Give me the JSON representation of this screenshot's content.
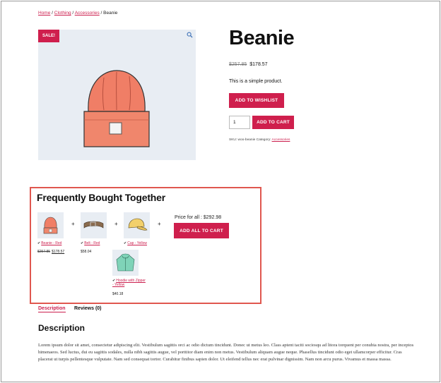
{
  "breadcrumb": {
    "links": [
      "Home",
      "Clothing",
      "Accessories"
    ],
    "separator": " / ",
    "current": "Beanie"
  },
  "gallery": {
    "badge": "SALE!",
    "zoom_icon": "magnifier-icon",
    "image": "beanie-illustration"
  },
  "product": {
    "title": "Beanie",
    "price_old": "$257.85",
    "price_new": "$178.57",
    "short_description": "This is a simple product.",
    "wishlist_label": "ADD TO WISHLIST",
    "quantity": "1",
    "add_to_cart_label": "ADD TO CART",
    "meta_prefix": "SKU: woo-beanie Category: ",
    "category": "Accessories"
  },
  "fbt": {
    "title": "Frequently Bought Together",
    "plus": "+",
    "check": "✔",
    "total_label": "Price for all : $292.98",
    "add_all_label": "ADD ALL TO CART",
    "items": [
      {
        "name": "Beanie - Red",
        "price_old": "$257.85",
        "price_new": "$178.57",
        "icon": "beanie-icon"
      },
      {
        "name": "Belt - Red",
        "price": "$58.04",
        "icon": "belt-icon"
      },
      {
        "name": "Cap - Yellow",
        "icon": "cap-icon"
      },
      {
        "name": "Hoodie with Zipper - Yellow",
        "price": "$40.18",
        "icon": "hoodie-icon"
      }
    ]
  },
  "tabs": {
    "description": "Description",
    "reviews": "Reviews (0)"
  },
  "description": {
    "heading": "Description",
    "body": "Lorem ipsum dolor sit amet, consectetur adipiscing elit. Vestibulum sagittis orci ac odio dictum tincidunt. Donec ut metus leo. Class aptent taciti sociosqu ad litora torquent per conubia nostra, per inceptos himenaeos. Sed luctus, dui eu sagittis sodales, nulla nibh sagittis augue, vel porttitor diam enim non metus. Vestibulum aliquam augue neque. Phasellus tincidunt odio eget ullamcorper efficitur. Cras placerat ut turpis pellentesque vulputate. Nam sed consequat tortor. Curabitur finibus sapien dolor. Ut eleifend tellus nec erat pulvinar dignissim. Nam non arcu purus. Vivamus et massa massa."
  },
  "colors": {
    "accent": "#cf1f4d",
    "highlight_border": "#e0574f",
    "thumb_bg": "#e8edf3"
  }
}
